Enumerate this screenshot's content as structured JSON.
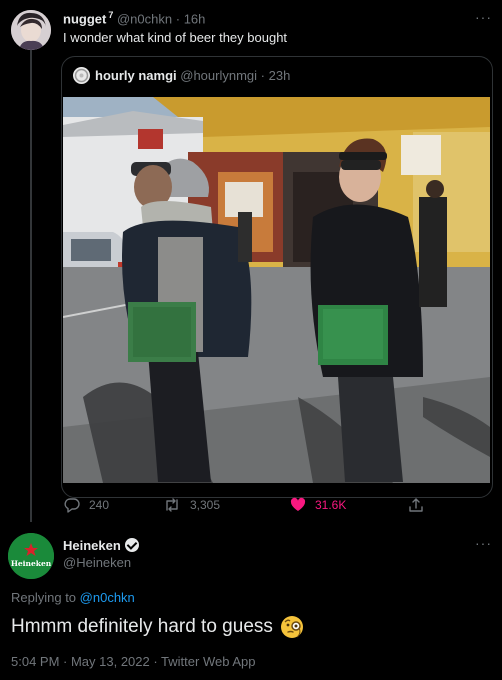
{
  "tweet": {
    "display_name": "nugget",
    "superscript": "7",
    "handle": "@n0chkn",
    "separator": "·",
    "time_ago": "16h",
    "text": "I wonder what kind of beer they bought"
  },
  "quoted": {
    "display_name": "hourly namgi",
    "handle": "@hourlynmgi",
    "separator": "·",
    "time_ago": "23h"
  },
  "actions": {
    "reply_count": "240",
    "retweet_count": "3,305",
    "like_count": "31.6K",
    "like_color": "#f91880"
  },
  "reply": {
    "display_name": "Heineken",
    "handle": "@Heineken",
    "avatar_text": "Heineken",
    "replying_prefix": "Replying to",
    "replying_to": "@n0chkn",
    "text": "Hmmm definitely hard to guess",
    "emoji": "face-with-monocle",
    "timestamp": "5:04 PM · May 13, 2022 · Twitter Web App"
  },
  "more_label": "···",
  "colors": {
    "background": "#000000",
    "link": "#1d9bf0",
    "heineken_green": "#1a8a3a"
  }
}
